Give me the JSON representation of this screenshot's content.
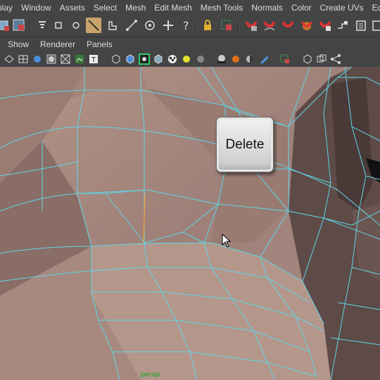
{
  "menu": {
    "items": [
      "play",
      "Window",
      "Assets",
      "Select",
      "Mesh",
      "Edit Mesh",
      "Mesh Tools",
      "Normals",
      "Color",
      "Create UVs",
      "Edit UVs"
    ]
  },
  "toolbar": {
    "icons": [
      "select-vertex-icon",
      "select-face-icon",
      "soft-select-icon",
      "cube-icon",
      "sphere-icon",
      "multi-cut-icon",
      "extrude-icon",
      "append-icon",
      "target-weld-icon",
      "move-icon",
      "help-icon",
      "lock-icon",
      "select-object-icon",
      "magnet-icon",
      "magnet-curve-icon",
      "magnet-surface-icon",
      "magnet-live-icon",
      "magnet-view-icon",
      "snap-icon",
      "history-icon"
    ]
  },
  "panel_menu": {
    "items": [
      "Show",
      "Renderer",
      "Panels"
    ]
  },
  "key_overlay": {
    "label": "Delete"
  },
  "viewport": {
    "camera_label": "persp",
    "wire_color": "#5fd6e8",
    "selected_edge_color": "#f0a040",
    "skin_color": "#a88a80"
  },
  "colors": {
    "ui_background": "#444444",
    "text": "#dddddd",
    "active_tool": "#c9a36c"
  }
}
